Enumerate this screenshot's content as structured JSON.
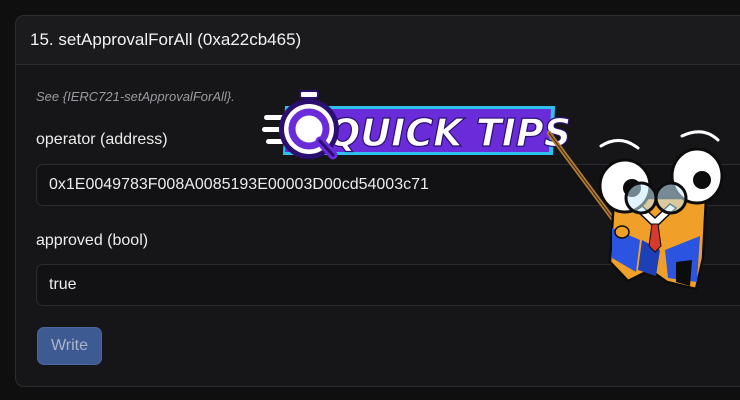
{
  "panel": {
    "title": "15. setApprovalForAll (0xa22cb465)",
    "hint": "See {IERC721-setApprovalForAll}."
  },
  "fields": [
    {
      "label": "operator (address)",
      "value": "0x1E0049783F008A0085193E00003D00cd54003c71"
    },
    {
      "label": "approved (bool)",
      "value": "true"
    }
  ],
  "actions": {
    "write_label": "Write"
  },
  "overlay": {
    "logo_text": "QUICK TIPS",
    "icon": "stopwatch-magnifier-icon",
    "mascot": "professor-mascot-with-pointer",
    "colors": {
      "logo_purple": "#6a2bd9",
      "logo_border": "#2fc1ee",
      "mascot_orange": "#f0a028",
      "mascot_blue": "#2b55e0"
    }
  }
}
